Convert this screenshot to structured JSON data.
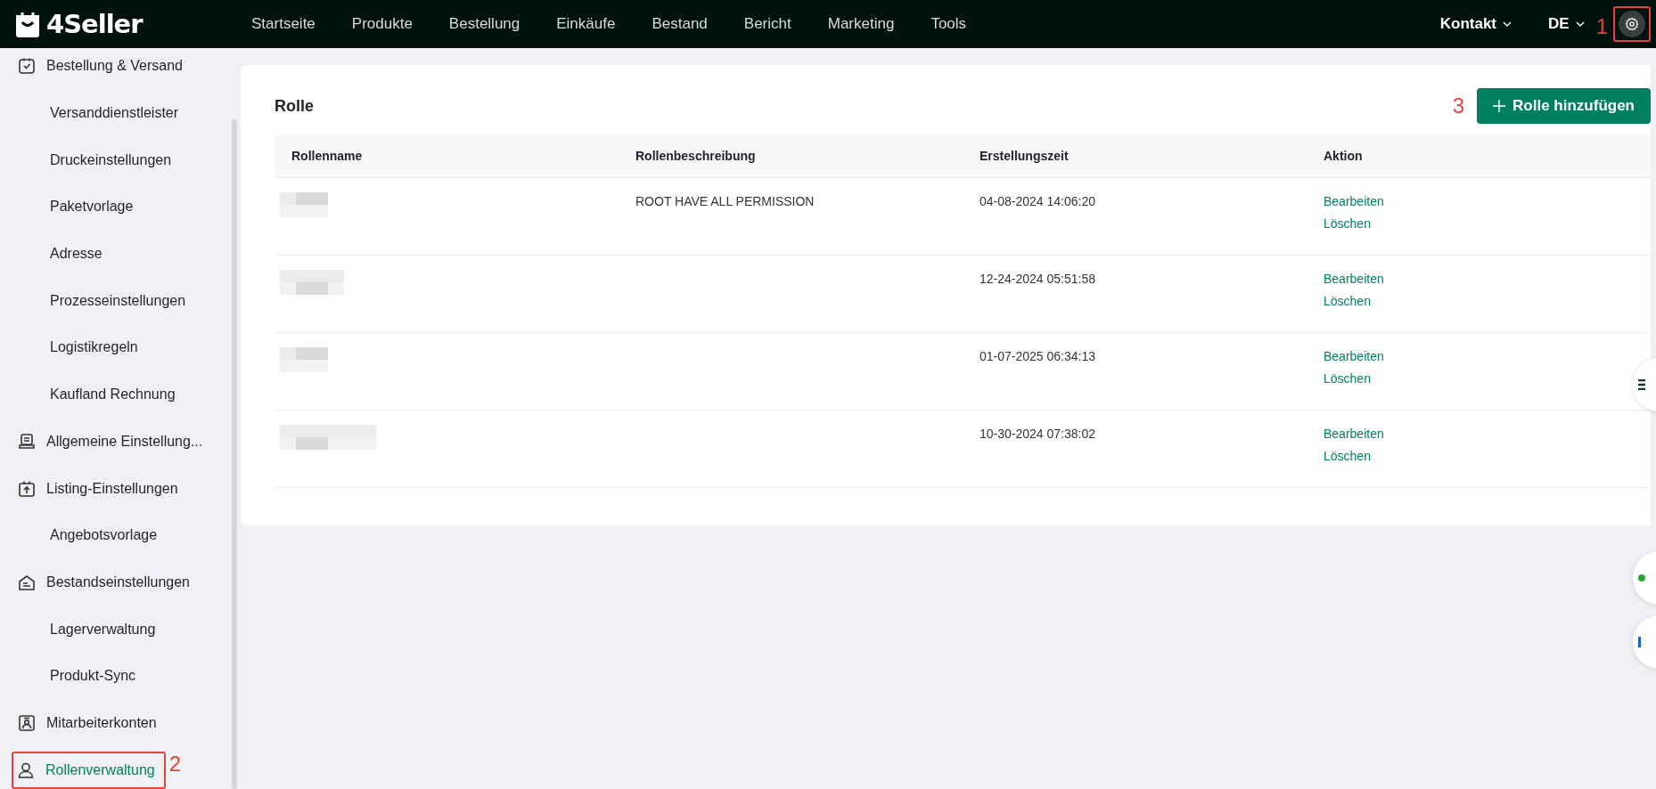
{
  "topbar": {
    "logo": "4Seller",
    "nav": [
      {
        "label": "Startseite"
      },
      {
        "label": "Produkte"
      },
      {
        "label": "Bestellung"
      },
      {
        "label": "Einkäufe"
      },
      {
        "label": "Bestand"
      },
      {
        "label": "Bericht"
      },
      {
        "label": "Marketing"
      },
      {
        "label": "Tools"
      }
    ],
    "contact": "Kontakt",
    "language": "DE",
    "settings_annotation": "1"
  },
  "sidebar": {
    "items": [
      {
        "label": "Bestellung & Versand",
        "kind": "order",
        "selected": false,
        "children": [
          {
            "label": "Versanddienstleister",
            "selected": false
          },
          {
            "label": "Druckeinstellungen",
            "selected": false
          },
          {
            "label": "Paketvorlage",
            "selected": false
          },
          {
            "label": "Adresse",
            "selected": false
          },
          {
            "label": "Prozesseinstellungen",
            "selected": false
          },
          {
            "label": "Logistikregeln",
            "selected": false
          },
          {
            "label": "Kaufland Rechnung",
            "selected": false
          }
        ]
      },
      {
        "label": "Allgemeine Einstellung...",
        "kind": "general",
        "selected": false
      },
      {
        "label": "Listing-Einstellungen",
        "kind": "listing",
        "selected": false,
        "children": [
          {
            "label": "Angebotsvorlage",
            "selected": false
          }
        ]
      },
      {
        "label": "Bestandseinstellungen",
        "kind": "stock",
        "selected": false,
        "children": [
          {
            "label": "Lagerverwaltung",
            "selected": false
          },
          {
            "label": "Produkt-Sync",
            "selected": false
          }
        ]
      },
      {
        "label": "Mitarbeiterkonten",
        "kind": "staff",
        "selected": false
      },
      {
        "label": "Rollenverwaltung",
        "kind": "user",
        "selected": true,
        "annotation": "2"
      }
    ]
  },
  "main": {
    "title": "Rolle",
    "add_button": {
      "label": "Rolle hinzufügen",
      "annotation": "3"
    },
    "table": {
      "columns": [
        "Rollenname",
        "Rollenbeschreibung",
        "Erstellungszeit",
        "Aktion"
      ],
      "rows": [
        {
          "description": "ROOT HAVE ALL PERMISSION",
          "created": "04-08-2024 14:06:20",
          "actions": [
            "Bearbeiten",
            "Löschen"
          ]
        },
        {
          "created": "12-24-2024 05:51:58",
          "actions": [
            "Bearbeiten",
            "Löschen"
          ]
        },
        {
          "created": "01-07-2025 06:34:13",
          "actions": [
            "Bearbeiten",
            "Löschen"
          ]
        },
        {
          "created": "10-30-2024 07:38:02",
          "actions": [
            "Bearbeiten",
            "Löschen"
          ]
        }
      ]
    }
  }
}
